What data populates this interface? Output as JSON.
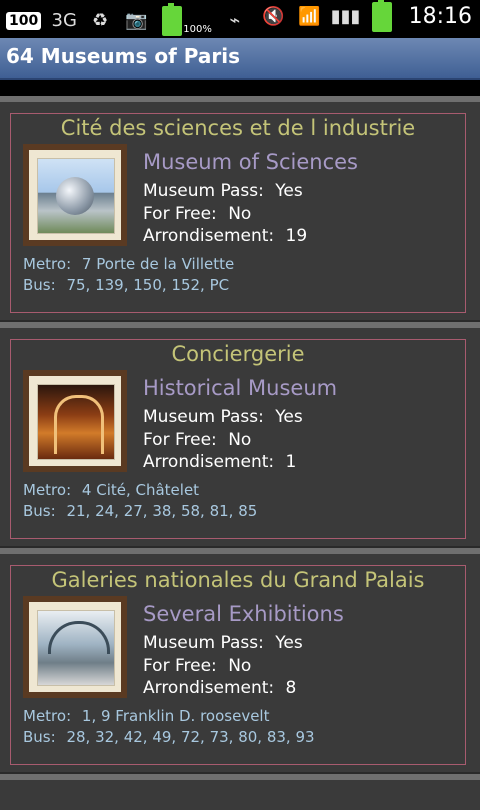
{
  "status_bar": {
    "notification_badge": "100",
    "battery_percent": "100%",
    "time": "18:16",
    "icons": [
      "3g-icon",
      "recycle-icon",
      "camera-icon",
      "battery-icon",
      "usb-icon",
      "mute-icon",
      "wifi-icon",
      "signal-icon",
      "battery-full-icon"
    ]
  },
  "app": {
    "title": "64 Museums of Paris"
  },
  "museums": [
    {
      "name": "Cité des sciences et de l industrie",
      "category": "Museum of Sciences",
      "museum_pass_label": "Museum Pass:",
      "museum_pass": "Yes",
      "for_free_label": "For Free:",
      "for_free": "No",
      "arrondissement_label": "Arrondisement:",
      "arrondissement": "19",
      "metro_label": "Metro:",
      "metro": "7 Porte de la Villette",
      "bus_label": "Bus:",
      "bus": "75, 139, 150, 152, PC"
    },
    {
      "name": "Conciergerie",
      "category": "Historical Museum",
      "museum_pass_label": "Museum Pass:",
      "museum_pass": "Yes",
      "for_free_label": "For Free:",
      "for_free": "No",
      "arrondissement_label": "Arrondisement:",
      "arrondissement": "1",
      "metro_label": "Metro:",
      "metro": "4 Cité, Châtelet",
      "bus_label": "Bus:",
      "bus": "21, 24, 27, 38, 58, 81, 85"
    },
    {
      "name": "Galeries nationales du Grand Palais",
      "category": "Several Exhibitions",
      "museum_pass_label": "Museum Pass:",
      "museum_pass": "Yes",
      "for_free_label": "For Free:",
      "for_free": "No",
      "arrondissement_label": "Arrondisement:",
      "arrondissement": "8",
      "metro_label": "Metro:",
      "metro": "1, 9 Franklin D. roosevelt",
      "bus_label": "Bus:",
      "bus": "28, 32, 42, 49, 72, 73, 80, 83, 93"
    }
  ],
  "colors": {
    "title_bar": "#4f6f9f",
    "card_border": "#a85b6f",
    "name": "#c4c478",
    "category": "#a79ac6",
    "transport": "#a8c8df"
  }
}
